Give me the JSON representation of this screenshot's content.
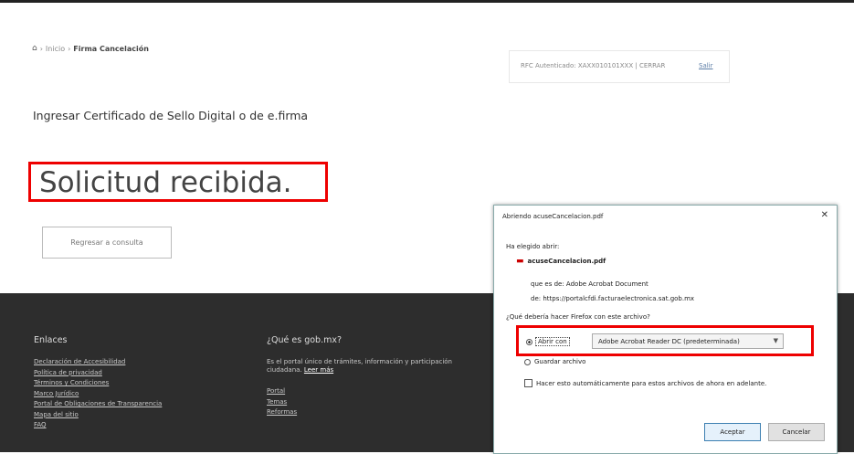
{
  "breadcrumb": {
    "home_icon": "home-icon",
    "separator": "›",
    "start": "Inicio",
    "current": "Firma Cancelación"
  },
  "rfc_box": {
    "text": "RFC Autenticado: XAXX010101XXX | CERRAR",
    "link": "Salir"
  },
  "main": {
    "subtitle": "Ingresar Certificado de Sello Digital o de e.firma",
    "title": "Solicitud recibida.",
    "button": "Regresar a consulta"
  },
  "footer": {
    "col1": {
      "heading": "Enlaces",
      "links": [
        "Declaración de Accesibilidad",
        "Política de privacidad",
        "Términos y Condiciones",
        "Marco Jurídico",
        "Portal de Obligaciones de Transparencia",
        "Mapa del sitio",
        "FAQ"
      ]
    },
    "col2": {
      "heading": "¿Qué es gob.mx?",
      "paragraph": "Es el portal único de trámites, información y participación ciudadana.",
      "more_link": "Leer más",
      "links": [
        "Portal",
        "Temas",
        "Reformas"
      ]
    }
  },
  "dialog": {
    "title": "Abriendo acuseCancelacion.pdf",
    "close": "✕",
    "label_chosen": "Ha elegido abrir:",
    "file_icon": "pdf-file-icon",
    "filename": "acuseCancelacion.pdf",
    "type_line": "que es de: Adobe Acrobat Document",
    "from_line": "de: https://portalcfdi.facturaelectronica.sat.gob.mx",
    "question": "¿Qué debería hacer Firefox con este archivo?",
    "open_with_label": "Abrir con",
    "open_with_value": "Adobe Acrobat Reader DC (predeterminada)",
    "save_label": "Guardar archivo",
    "remember_label": "Hacer esto automáticamente para estos archivos de ahora en adelante.",
    "ok": "Aceptar",
    "cancel": "Cancelar"
  }
}
